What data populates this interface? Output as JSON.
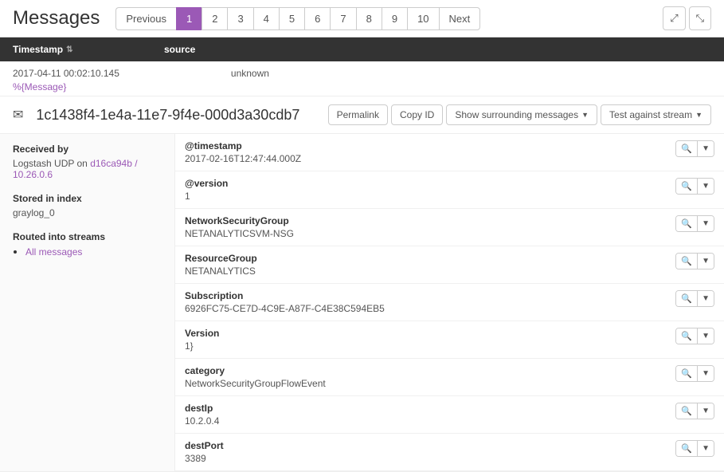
{
  "header": {
    "title": "Messages",
    "expandIcon1": "⤢",
    "expandIcon2": "⤡"
  },
  "pagination": {
    "previous": "Previous",
    "next": "Next",
    "pages": [
      "1",
      "2",
      "3",
      "4",
      "5",
      "6",
      "7",
      "8",
      "9",
      "10"
    ],
    "active": "1"
  },
  "table": {
    "col_timestamp": "Timestamp",
    "col_source": "source"
  },
  "message": {
    "timestamp": "2017-04-11 00:02:10.145",
    "source": "unknown",
    "link": "%{Message}",
    "id": "1c1438f4-1e4a-11e7-9f4e-000d3a30cdb7",
    "actions": {
      "permalink": "Permalink",
      "copy_id": "Copy ID",
      "show_surrounding": "Show surrounding messages",
      "test_against_stream": "Test against stream"
    }
  },
  "meta": {
    "received_by_label": "Received by",
    "received_by_value": "Logstash UDP on",
    "received_by_node": "d16ca94b / 10.26.0.6",
    "stored_in_label": "Stored in index",
    "stored_in_value": "graylog_0",
    "routed_into_label": "Routed into streams",
    "stream_name": "All messages"
  },
  "fields": [
    {
      "name": "@timestamp",
      "value": "2017-02-16T12:47:44.000Z"
    },
    {
      "name": "@version",
      "value": "1"
    },
    {
      "name": "NetworkSecurityGroup",
      "value": "NETANALYTICSVM-NSG"
    },
    {
      "name": "ResourceGroup",
      "value": "NETANALYTICS"
    },
    {
      "name": "Subscription",
      "value": "6926FC75-CE7D-4C9E-A87F-C4E38C594EB5"
    },
    {
      "name": "Version",
      "value": "1}"
    },
    {
      "name": "category",
      "value": "NetworkSecurityGroupFlowEvent"
    },
    {
      "name": "destIp",
      "value": "10.2.0.4"
    },
    {
      "name": "destPort",
      "value": "3389"
    }
  ]
}
